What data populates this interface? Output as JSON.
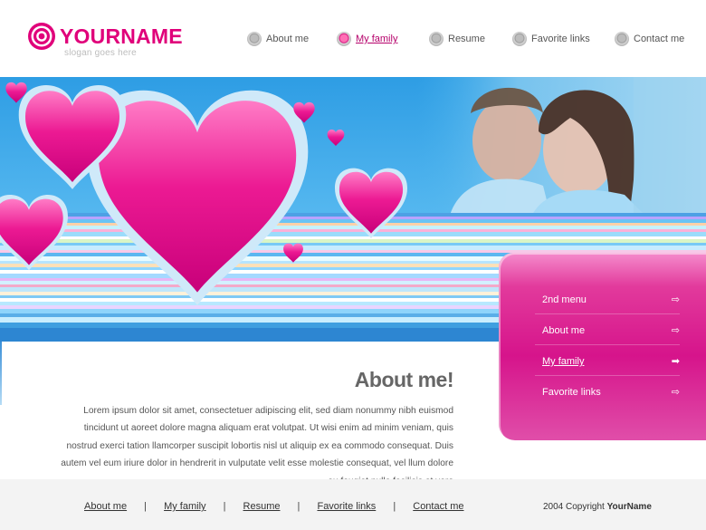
{
  "brand": {
    "name": "YOURNAME",
    "slogan": "slogan goes here",
    "accent_color": "#e0007a"
  },
  "top_nav": {
    "items": [
      {
        "label": "About me",
        "icon": "circle-bullet-icon",
        "active": false
      },
      {
        "label": "My family",
        "icon": "circle-bullet-icon",
        "active": true
      },
      {
        "label": "Resume",
        "icon": "circle-bullet-icon",
        "active": false
      },
      {
        "label": "Favorite links",
        "icon": "circle-bullet-icon",
        "active": false
      },
      {
        "label": "Contact me",
        "icon": "circle-bullet-icon",
        "active": false
      }
    ]
  },
  "side_menu": {
    "items": [
      {
        "label": "2nd menu",
        "icon": "arrow-right-icon",
        "active": false
      },
      {
        "label": "About me",
        "icon": "arrow-right-icon",
        "active": false
      },
      {
        "label": "My family",
        "icon": "arrow-right-icon",
        "active": true
      },
      {
        "label": "Favorite links",
        "icon": "arrow-right-icon",
        "active": false
      }
    ]
  },
  "content": {
    "title": "About me!",
    "paragraph": "Lorem ipsum dolor sit amet, consectetuer adipiscing elit, sed diam nonummy nibh euismod tincidunt ut aoreet dolore magna aliquam erat volutpat. Ut wisi enim ad minim veniam, quis nostrud exerci tation llamcorper suscipit lobortis nisl ut aliquip ex ea commodo consequat. Duis autem vel eum iriure dolor in hendrerit in vulputate velit esse molestie consequat, vel llum dolore eu feugiat nulla facilisis at vero"
  },
  "footer": {
    "links": [
      "About me",
      "My family",
      "Resume",
      "Favorite links",
      "Contact me"
    ],
    "separator": "|",
    "copyright_prefix": "2004 Copyright",
    "copyright_name": "YourName"
  },
  "colors": {
    "pink": "#d6148b",
    "sky_blue": "#4ab4ee",
    "footer_bg": "#f3f3f3"
  }
}
